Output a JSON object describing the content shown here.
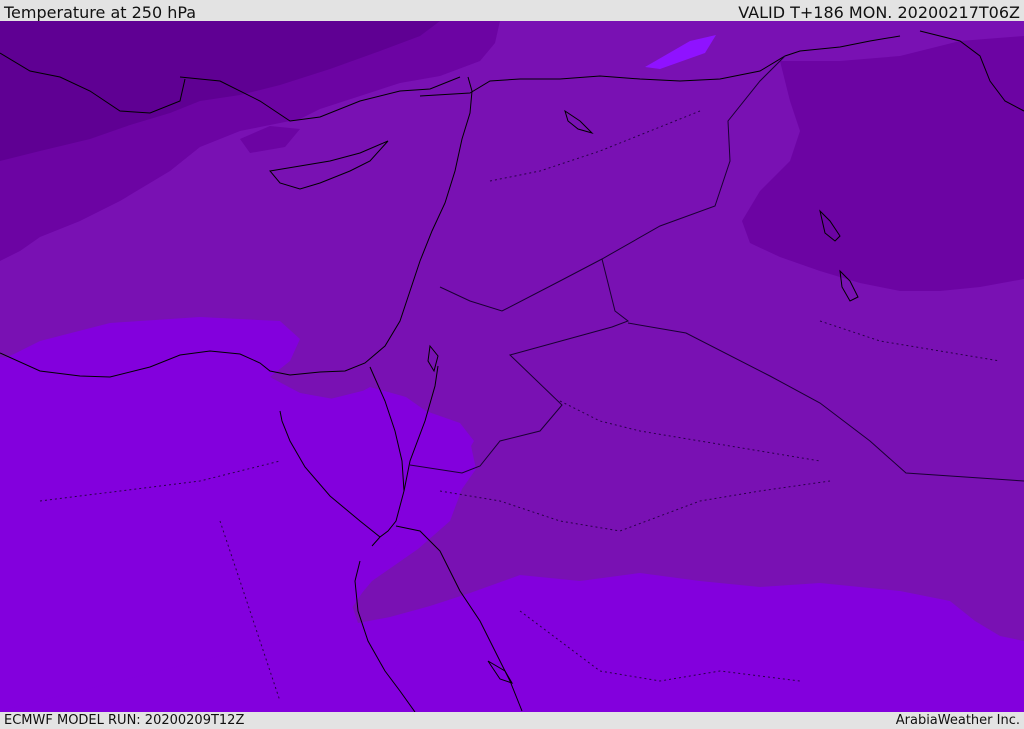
{
  "header": {
    "title": "Temperature at 250 hPa",
    "valid": "VALID T+186 MON. 20200217T06Z"
  },
  "footer": {
    "model_run": "ECMWF MODEL RUN: 20200209T12Z",
    "credit": "ArabiaWeather Inc."
  },
  "colors": {
    "band_darkest": "#5f0093",
    "band_dark": "#6c04a3",
    "band_mid": "#7911b3",
    "band_light": "#8300dd",
    "band_brightest": "#8f12ff",
    "coastline": "#000000",
    "border": "#1a0033",
    "frame_background": "#e3e3e3"
  }
}
